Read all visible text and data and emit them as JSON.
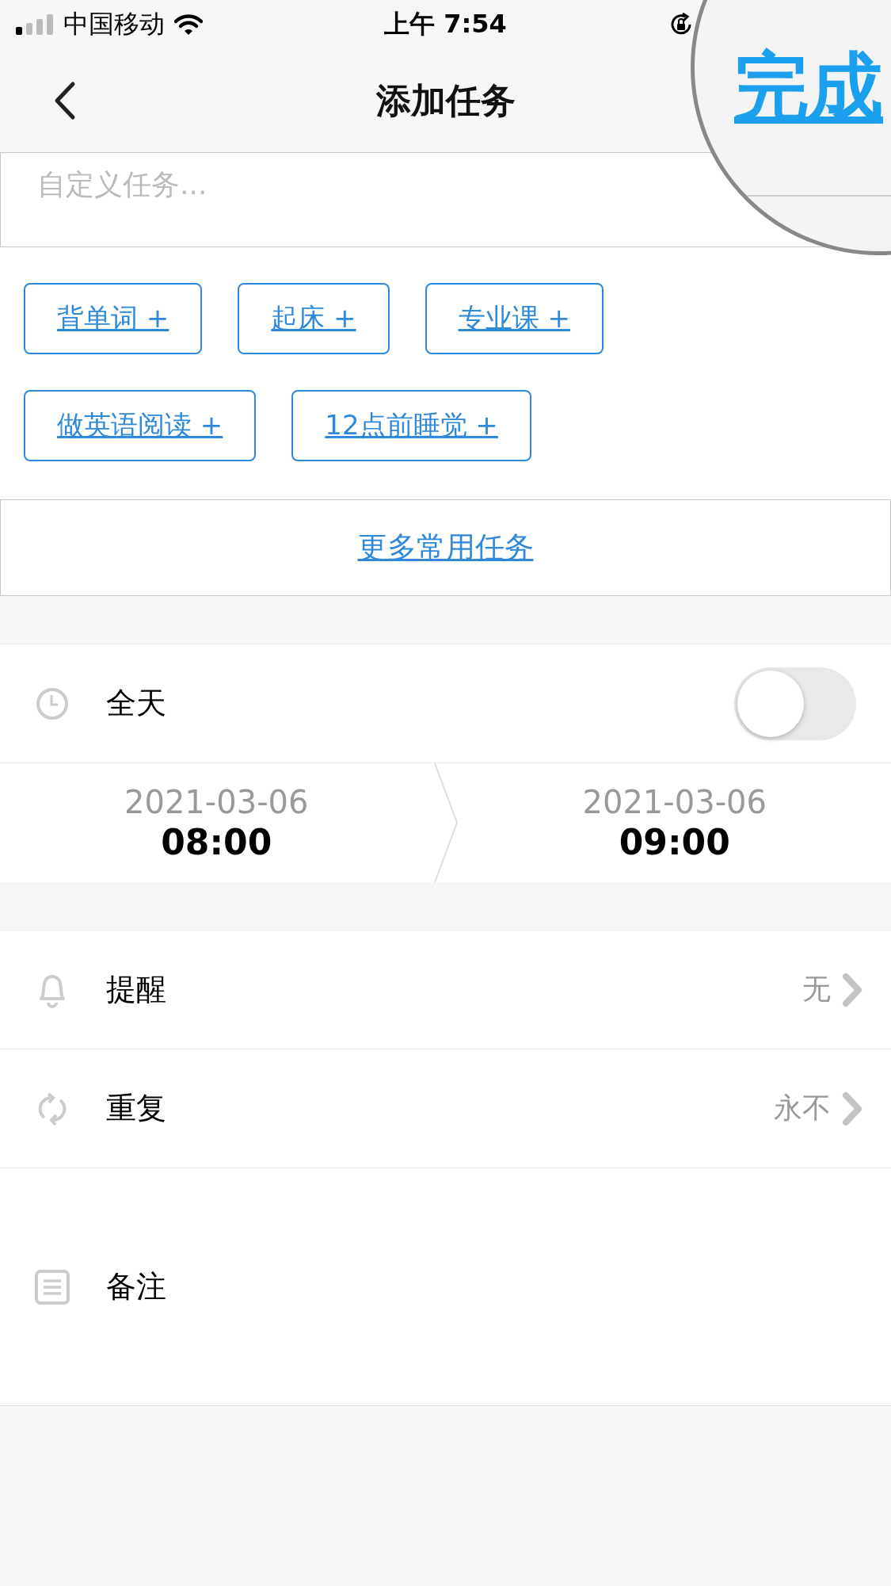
{
  "status_bar": {
    "carrier": "中国移动",
    "time": "上午 7:54"
  },
  "nav": {
    "title": "添加任务",
    "done": "完成"
  },
  "task_input": {
    "placeholder": "自定义任务..."
  },
  "quick_tasks": [
    {
      "label": "背单词 +"
    },
    {
      "label": "起床 +"
    },
    {
      "label": "专业课 +"
    },
    {
      "label": "做英语阅读 +"
    },
    {
      "label": "12点前睡觉 +"
    }
  ],
  "more_tasks": "更多常用任务",
  "all_day": {
    "label": "全天",
    "on": false
  },
  "start": {
    "date": "2021-03-06",
    "time": "08:00"
  },
  "end": {
    "date": "2021-03-06",
    "time": "09:00"
  },
  "settings": [
    {
      "kind": "reminder",
      "label": "提醒",
      "value": "无"
    },
    {
      "kind": "repeat",
      "label": "重复",
      "value": "永不"
    }
  ],
  "note": {
    "label": "备注"
  }
}
